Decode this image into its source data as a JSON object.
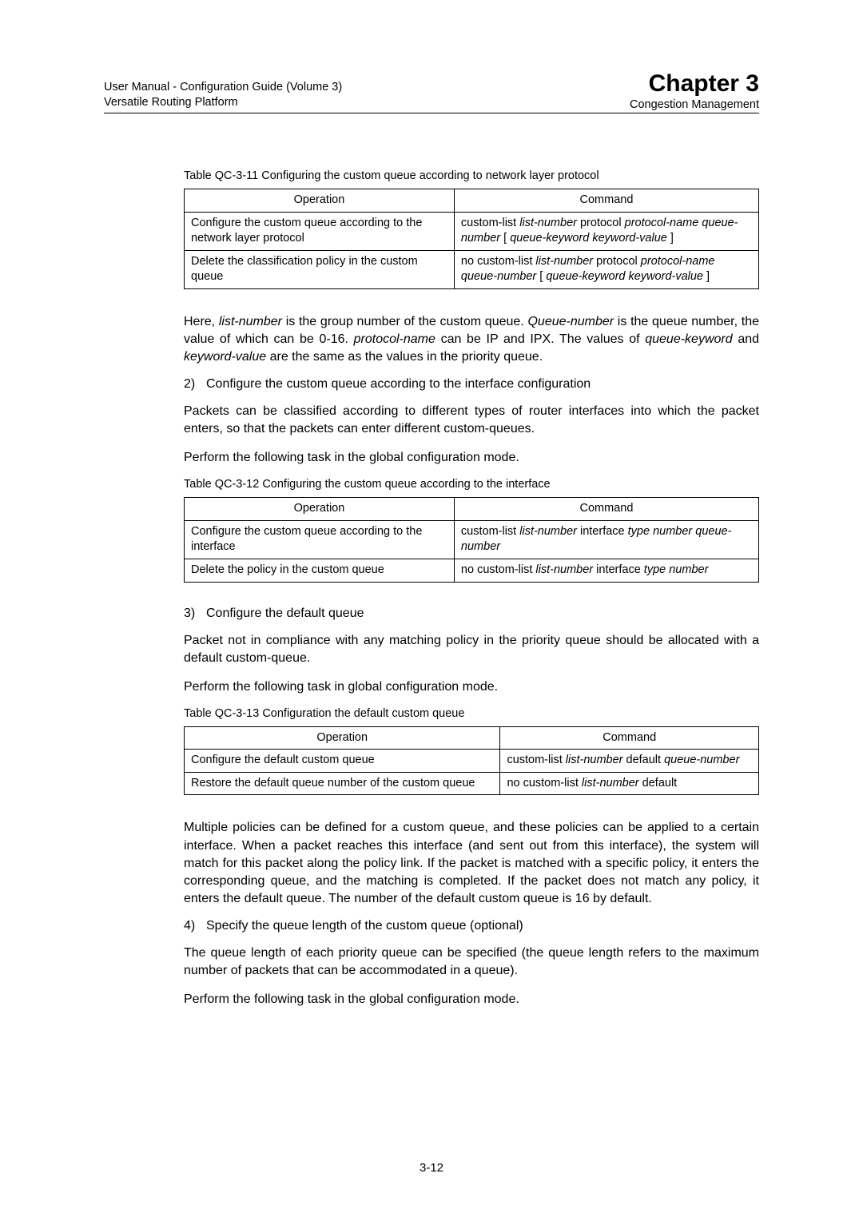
{
  "header": {
    "left1": "User Manual - Configuration Guide (Volume 3)",
    "left2": "Versatile Routing Platform",
    "chapter": "Chapter 3",
    "sub": "Congestion Management"
  },
  "caption1": "Table QC-3-11  Configuring the custom queue according to network layer protocol",
  "t1": {
    "h1": "Operation",
    "h2": "Command",
    "r1c1": "Configure the custom queue according to the network layer protocol",
    "r1c2a": "custom-list ",
    "r1c2b": "list-number",
    "r1c2c": " protocol ",
    "r1c2d": "protocol-name queue-number",
    "r1c2e": " [ ",
    "r1c2f": "queue-keyword  keyword-value",
    "r1c2g": " ]",
    "r2c1": "Delete the classification policy in the custom queue",
    "r2c2a": "no custom-list ",
    "r2c2b": "list-number",
    "r2c2c": " protocol ",
    "r2c2d": "protocol-name queue-number",
    "r2c2e": " [ ",
    "r2c2f": "queue-keyword  keyword-value",
    "r2c2g": " ]"
  },
  "p1a": "Here, ",
  "p1b": "list-number",
  "p1c": " is the group number of the custom queue. ",
  "p1d": "Queue-number",
  "p1e": " is the queue number, the value of which can be 0-16. ",
  "p1f": "protocol-name",
  "p1g": " can be IP and IPX.  The values of ",
  "p1h": "queue-keyword",
  "p1i": " and ",
  "p1j": "keyword-value",
  "p1k": " are the same as the values in the priority queue.",
  "n2num": "2)",
  "n2txt": "Configure the custom queue according to the interface configuration",
  "p2": "Packets can be classified according to different types of router interfaces into which the packet enters, so that the packets can enter different custom-queues.",
  "p3": "Perform the following task in the global configuration mode.",
  "caption2": "Table QC-3-12  Configuring the custom queue according to the interface",
  "t2": {
    "h1": "Operation",
    "h2": "Command",
    "r1c1": "Configure the custom queue according to the interface",
    "r1c2a": "custom-list ",
    "r1c2b": "list-number",
    "r1c2c": " interface ",
    "r1c2d": "type number queue-number",
    "r2c1": "Delete the policy in the custom queue",
    "r2c2a": "no custom-list ",
    "r2c2b": "list-number",
    "r2c2c": " interface ",
    "r2c2d": "type number"
  },
  "n3num": "3)",
  "n3txt": "Configure the default queue",
  "p4": "Packet not in compliance with any matching policy in the priority queue should be allocated with a default custom-queue.",
  "p5": "Perform the following task in global configuration mode.",
  "caption3": "Table QC-3-13  Configuration the default custom queue",
  "t3": {
    "h1": "Operation",
    "h2": "Command",
    "r1c1": "Configure the default custom queue",
    "r1c2a": "custom-list ",
    "r1c2b": "list-number",
    "r1c2c": " default  ",
    "r1c2d": "queue-number",
    "r2c1": "Restore the  default queue number of  the custom queue",
    "r2c2a": "no custom-list ",
    "r2c2b": "list-number",
    "r2c2c": " default"
  },
  "p6": "Multiple policies can be defined for a custom queue, and these policies can be applied to a certain interface. When a packet reaches this interface (and sent out from this interface), the system will match for this packet along the policy link. If the packet is matched with a specific policy, it enters the corresponding queue, and the matching is completed. If the packet does not match any policy, it enters the default queue. The number of the default custom queue is 16 by default.",
  "n4num": "4)",
  "n4txt": "Specify the queue length of the custom queue (optional)",
  "p7": "The queue length of each priority queue can be specified (the queue length refers to the maximum number of packets that can be accommodated in a queue).",
  "p8": "Perform the following task in the global configuration mode.",
  "pagenum": "3-12"
}
